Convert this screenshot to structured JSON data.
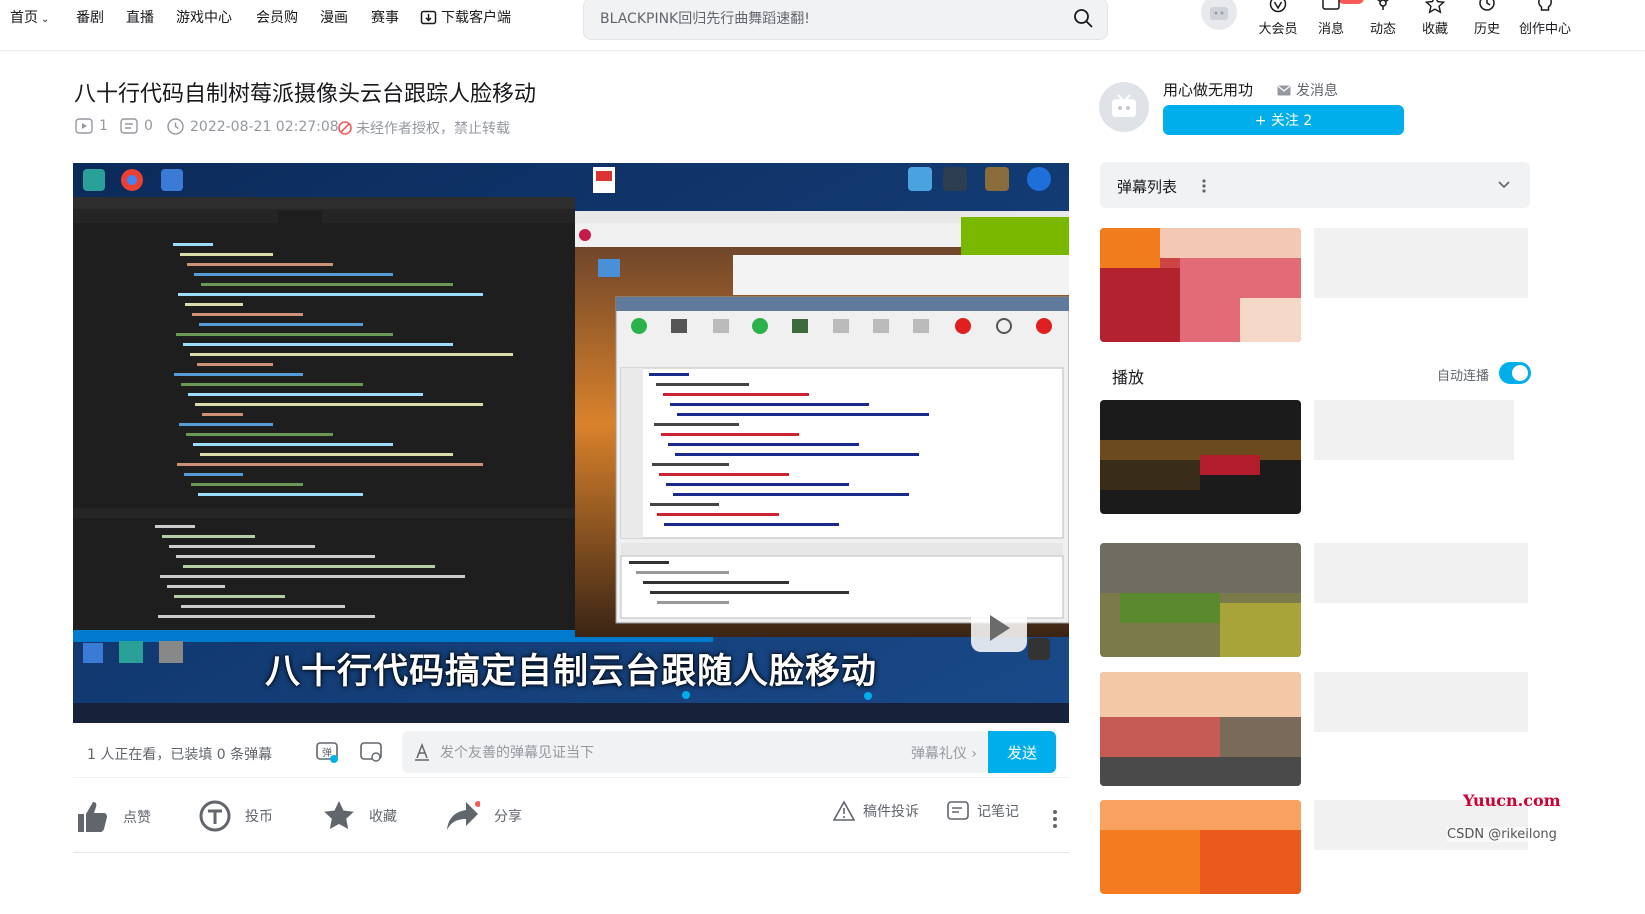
{
  "nav": {
    "home": "首页",
    "items": [
      "番剧",
      "直播",
      "游戏中心",
      "会员购",
      "漫画",
      "赛事"
    ],
    "download": "下载客户端"
  },
  "search": {
    "placeholder": "BLACKPINK回归先行曲舞蹈速翻!"
  },
  "toolbar": {
    "items": [
      {
        "label": "大会员",
        "icon": "vip-icon"
      },
      {
        "label": "消息",
        "icon": "message-icon"
      },
      {
        "label": "动态",
        "icon": "dynamic-icon"
      },
      {
        "label": "收藏",
        "icon": "favorite-icon"
      },
      {
        "label": "历史",
        "icon": "history-icon"
      },
      {
        "label": "创作中心",
        "icon": "creator-icon"
      }
    ]
  },
  "video": {
    "title": "八十行代码自制树莓派摄像头云台跟踪人脸移动",
    "views": "1",
    "danmaku_count": "0",
    "date": "2022-08-21 02:27:08",
    "copyright": "未经作者授权，禁止转载",
    "caption": "八十行代码搞定自制云台跟随人脸移动"
  },
  "danmaku_bar": {
    "status": "1 人正在看，已装填 0 条弹幕",
    "placeholder": "发个友善的弹幕见证当下",
    "etiquette": "弹幕礼仪 ›",
    "send": "发送"
  },
  "actions": {
    "like": "点赞",
    "coin": "投币",
    "favorite": "收藏",
    "share": "分享",
    "report": "稿件投诉",
    "note": "记笔记"
  },
  "uploader": {
    "name": "用心做无用功",
    "message": "发消息",
    "follow": "+ 关注 2"
  },
  "sidebar": {
    "danmaku_list": "弹幕列表",
    "autoplay_title": "播放",
    "autoplay_label": "自动连播"
  },
  "watermarks": {
    "site": "Yuucn.com",
    "csdn": "CSDN @rikeilong"
  },
  "colors": {
    "accent": "#00aeec",
    "text": "#18191c",
    "muted": "#9499a0"
  }
}
